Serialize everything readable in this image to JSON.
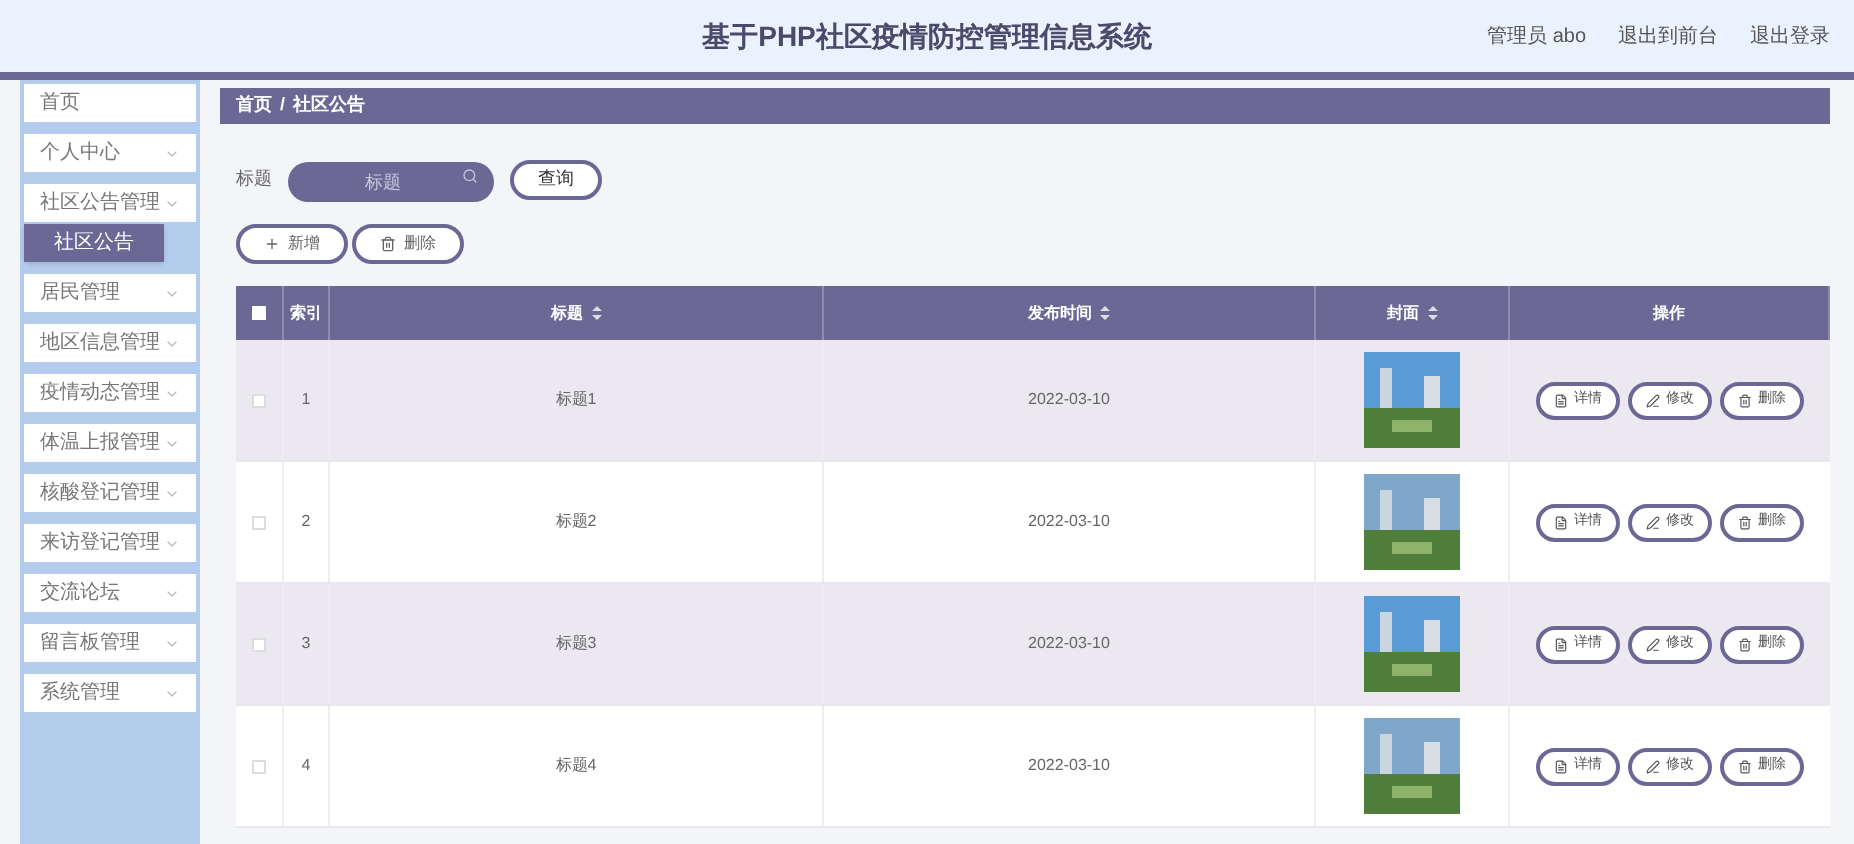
{
  "header": {
    "title": "基于PHP社区疫情防控管理信息系统",
    "links": [
      "管理员 abo",
      "退出到前台",
      "退出登录"
    ]
  },
  "sidebar": {
    "items": [
      {
        "label": "首页",
        "expandable": false,
        "selected": false
      },
      {
        "label": "个人中心",
        "expandable": true,
        "selected": false
      },
      {
        "label": "社区公告管理",
        "expandable": true,
        "selected": false,
        "children": [
          {
            "label": "社区公告",
            "selected": true
          }
        ]
      },
      {
        "label": "居民管理",
        "expandable": true,
        "selected": false
      },
      {
        "label": "地区信息管理",
        "expandable": true,
        "selected": false
      },
      {
        "label": "疫情动态管理",
        "expandable": true,
        "selected": false
      },
      {
        "label": "体温上报管理",
        "expandable": true,
        "selected": false
      },
      {
        "label": "核酸登记管理",
        "expandable": true,
        "selected": false
      },
      {
        "label": "来访登记管理",
        "expandable": true,
        "selected": false
      },
      {
        "label": "交流论坛",
        "expandable": true,
        "selected": false
      },
      {
        "label": "留言板管理",
        "expandable": true,
        "selected": false
      },
      {
        "label": "系统管理",
        "expandable": true,
        "selected": false
      }
    ]
  },
  "breadcrumb": [
    "首页",
    "/",
    "社区公告"
  ],
  "search": {
    "label": "标题",
    "placeholder": "标题",
    "button": "查询"
  },
  "actions": [
    "新增",
    "删除"
  ],
  "table": {
    "columns": [
      {
        "label": "索引",
        "sortable": false
      },
      {
        "label": "标题",
        "sortable": true
      },
      {
        "label": "发布时间",
        "sortable": true
      },
      {
        "label": "封面",
        "sortable": true
      },
      {
        "label": "操作",
        "sortable": false
      }
    ],
    "header_checked": false,
    "rows": [
      {
        "index": "1",
        "title": "标题1",
        "date": "2022-03-10",
        "checked": false,
        "buttons": [
          "详情",
          "修改",
          "删除"
        ]
      },
      {
        "index": "2",
        "title": "标题2",
        "date": "2022-03-10",
        "checked": false,
        "buttons": [
          "详情",
          "修改",
          "删除"
        ]
      },
      {
        "index": "3",
        "title": "标题3",
        "date": "2022-03-10",
        "checked": false,
        "buttons": [
          "详情",
          "修改",
          "删除"
        ]
      },
      {
        "index": "4",
        "title": "标题4",
        "date": "2022-03-10",
        "checked": false,
        "buttons": [
          "详情",
          "修改",
          "删除"
        ]
      }
    ]
  }
}
